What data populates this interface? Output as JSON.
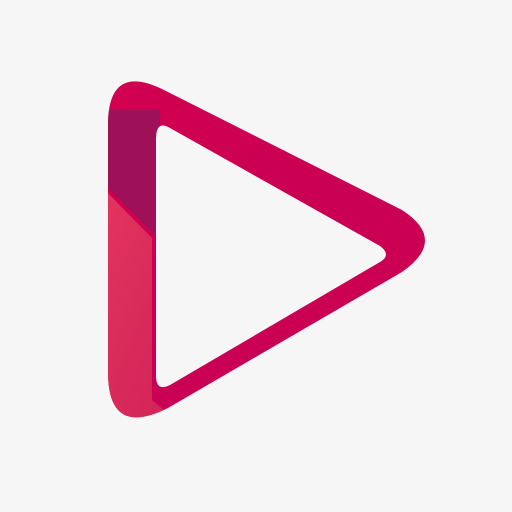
{
  "icon": {
    "name": "play-icon",
    "colors": {
      "background": "#f6f6f6",
      "primary": "#d6004e",
      "accent_dark": "#9e1058",
      "accent_light": "#e6375f",
      "inner": "#f6f6f6"
    }
  }
}
